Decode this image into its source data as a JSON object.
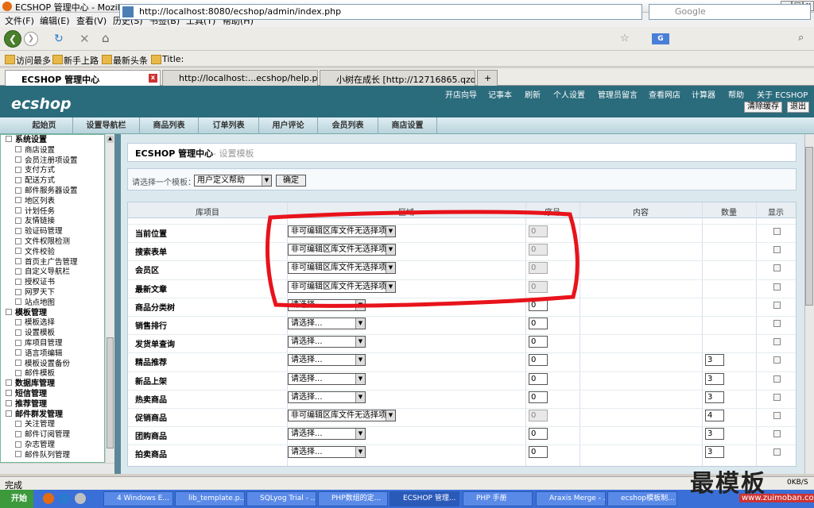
{
  "window": {
    "title": "ECSHOP 管理中心 - Mozilla Firefox"
  },
  "menu": [
    "文件(F)",
    "编辑(E)",
    "查看(V)",
    "历史(S)",
    "书签(B)",
    "工具(T)",
    "帮助(H)"
  ],
  "nav": {
    "url": "http://localhost:8080/ecshop/admin/index.php",
    "search_placeholder": "Google"
  },
  "bookmarks": [
    "访问最多",
    "新手上路",
    "最新头条",
    "Title:"
  ],
  "tabs": [
    "ECSHOP 管理中心",
    "http://localhost:...ecshop/help.php",
    "小树在成长 [http://12716865.qzo..."
  ],
  "ecshop": {
    "logo": "ecshop",
    "toplinks": [
      "开店向导",
      "记事本",
      "刷新",
      "个人设置",
      "管理员留言",
      "查看网店",
      "计算器",
      "帮助",
      "关于 ECSHOP"
    ],
    "clear_cache": "清除缓存",
    "logout": "退出",
    "main_tabs": [
      "起始页",
      "设置导航栏",
      "商品列表",
      "订单列表",
      "用户评论",
      "会员列表",
      "商店设置"
    ]
  },
  "sidebar": [
    {
      "label": "系统设置",
      "group": true
    },
    {
      "label": "商店设置"
    },
    {
      "label": "会员注册项设置"
    },
    {
      "label": "支付方式"
    },
    {
      "label": "配送方式"
    },
    {
      "label": "邮件服务器设置"
    },
    {
      "label": "地区列表"
    },
    {
      "label": "计划任务"
    },
    {
      "label": "友情链接"
    },
    {
      "label": "验证码管理"
    },
    {
      "label": "文件权限检测"
    },
    {
      "label": "文件校验"
    },
    {
      "label": "首页主广告管理"
    },
    {
      "label": "自定义导航栏"
    },
    {
      "label": "授权证书"
    },
    {
      "label": "网罗天下"
    },
    {
      "label": "站点地图"
    },
    {
      "label": "模板管理",
      "group": true
    },
    {
      "label": "模板选择"
    },
    {
      "label": "设置模板"
    },
    {
      "label": "库项目管理"
    },
    {
      "label": "语言项编辑"
    },
    {
      "label": "模板设置备份"
    },
    {
      "label": "邮件模板"
    },
    {
      "label": "数据库管理",
      "group": true
    },
    {
      "label": "短信管理",
      "group": true
    },
    {
      "label": "推荐管理",
      "group": true
    },
    {
      "label": "邮件群发管理",
      "group": true
    },
    {
      "label": "关注管理"
    },
    {
      "label": "邮件订阅管理"
    },
    {
      "label": "杂志管理"
    },
    {
      "label": "邮件队列管理"
    }
  ],
  "page": {
    "title": "ECSHOP 管理中心",
    "subtitle": "- 设置模板",
    "select_label": "请选择一个模板：",
    "select_value": "用户定义帮助",
    "confirm": "确定"
  },
  "table": {
    "headers": [
      "库项目",
      "区域",
      "序号",
      "内容",
      "数量",
      "显示"
    ],
    "rows": [
      {
        "name": "当前位置",
        "region": "非可编辑区库文件无选择项",
        "order": "0",
        "order_disabled": true,
        "qty": ""
      },
      {
        "name": "搜索表单",
        "region": "非可编辑区库文件无选择项",
        "order": "0",
        "order_disabled": true,
        "qty": ""
      },
      {
        "name": "会员区",
        "region": "非可编辑区库文件无选择项",
        "order": "0",
        "order_disabled": true,
        "qty": ""
      },
      {
        "name": "最新文章",
        "region": "非可编辑区库文件无选择项",
        "order": "0",
        "order_disabled": true,
        "qty": ""
      },
      {
        "name": "商品分类树",
        "region": "请选择...",
        "order": "0",
        "order_disabled": false,
        "qty": ""
      },
      {
        "name": "销售排行",
        "region": "请选择...",
        "order": "0",
        "order_disabled": false,
        "qty": ""
      },
      {
        "name": "发货单查询",
        "region": "请选择...",
        "order": "0",
        "order_disabled": false,
        "qty": ""
      },
      {
        "name": "精品推荐",
        "region": "请选择...",
        "order": "0",
        "order_disabled": false,
        "qty": "3"
      },
      {
        "name": "新品上架",
        "region": "请选择...",
        "order": "0",
        "order_disabled": false,
        "qty": "3"
      },
      {
        "name": "热卖商品",
        "region": "请选择...",
        "order": "0",
        "order_disabled": false,
        "qty": "3"
      },
      {
        "name": "促销商品",
        "region": "非可编辑区库文件无选择项",
        "order": "0",
        "order_disabled": true,
        "qty": "4"
      },
      {
        "name": "团购商品",
        "region": "请选择...",
        "order": "0",
        "order_disabled": false,
        "qty": "3"
      },
      {
        "name": "拍卖商品",
        "region": "请选择...",
        "order": "0",
        "order_disabled": false,
        "qty": "3"
      }
    ]
  },
  "status": {
    "text": "完成",
    "speed": "0KB/S"
  },
  "taskbar": {
    "start": "开始",
    "items": [
      "4 Windows E...",
      "lib_template.p...",
      "SQLyog Trial - ...",
      "PHP数组的定...",
      "ECSHOP 管理...",
      "PHP 手册",
      "Araxis Merge - ...",
      "ecshop模板制..."
    ]
  },
  "watermark": {
    "text": "最模板",
    "url": "www.zuimoban.com"
  }
}
